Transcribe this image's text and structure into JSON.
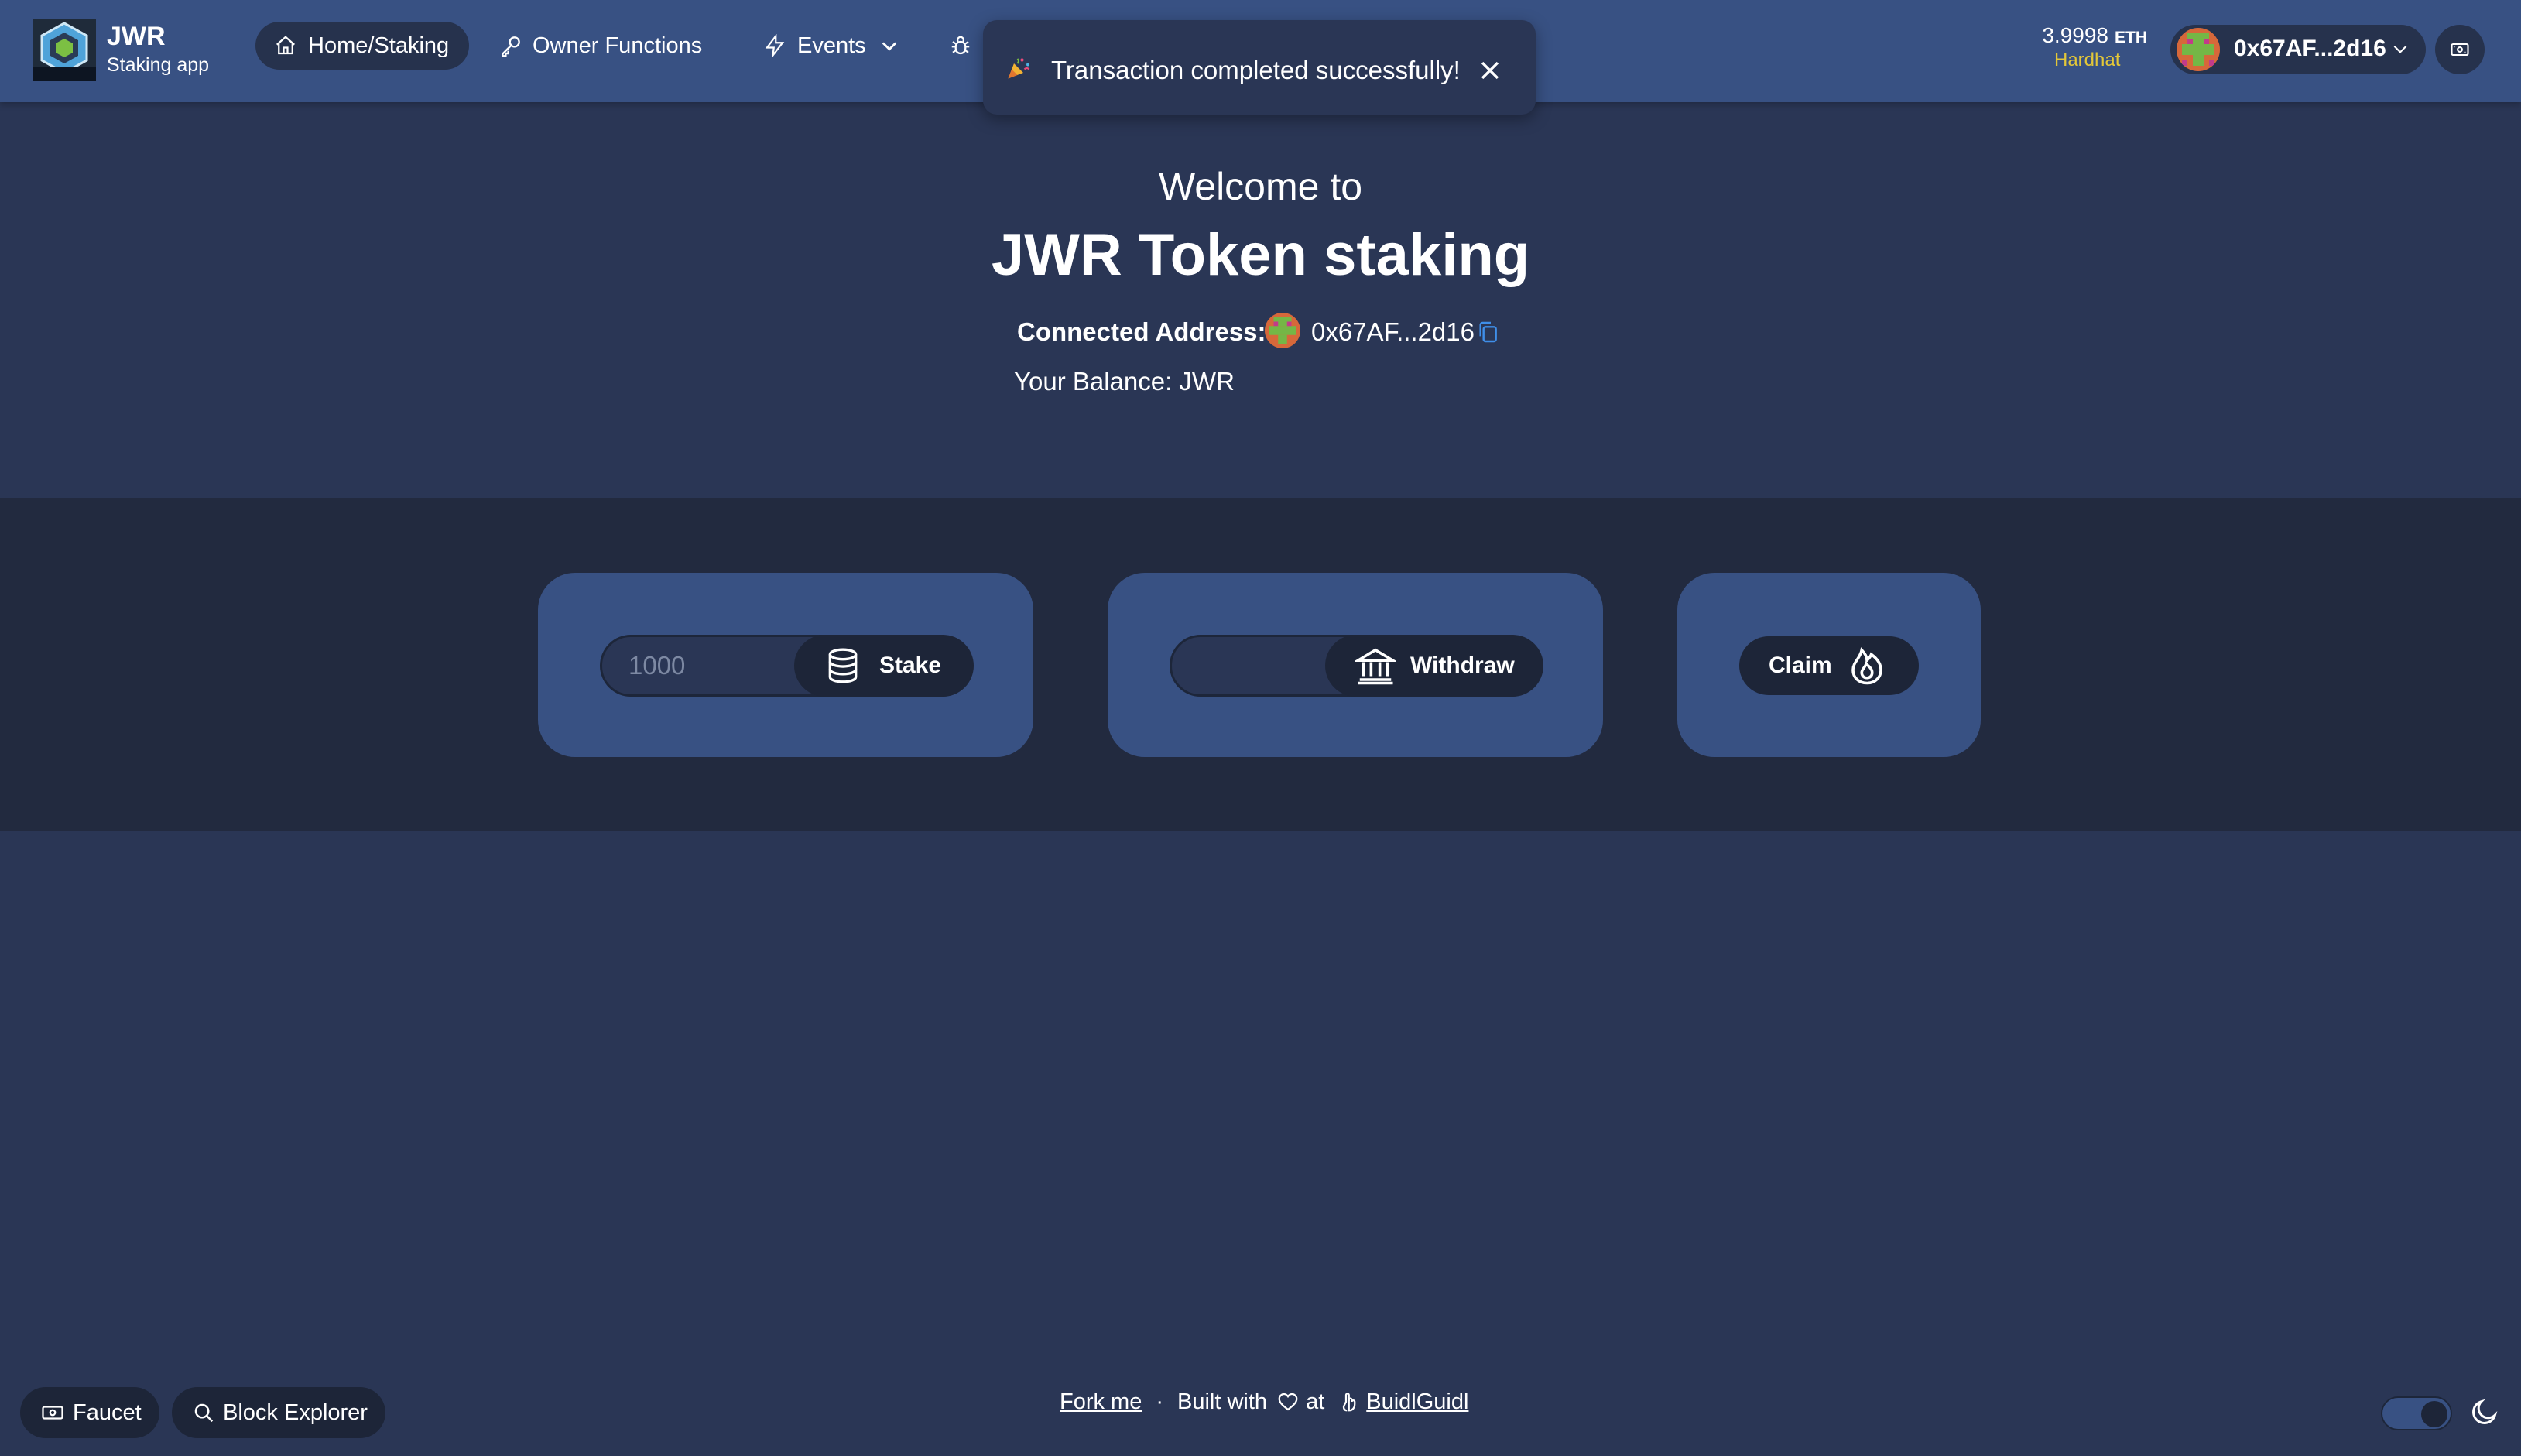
{
  "brand": {
    "title": "JWR",
    "subtitle": "Staking app",
    "logo_text": "JWR"
  },
  "nav": {
    "items": [
      {
        "label": "Home/Staking",
        "icon": "home-icon",
        "active": true
      },
      {
        "label": "Owner Functions",
        "icon": "key-icon",
        "active": false
      },
      {
        "label": "Events",
        "icon": "bolt-icon",
        "active": false,
        "dropdown": true
      }
    ]
  },
  "toast": {
    "message": "Transaction completed successfully!",
    "icon": "party-popper-icon"
  },
  "wallet": {
    "balance": "3.9998",
    "unit": "ETH",
    "network": "Hardhat",
    "address": "0x67AF...2d16"
  },
  "hero": {
    "welcome": "Welcome to",
    "title": "JWR Token staking",
    "connected_label": "Connected Address:",
    "address": "0x67AF...2d16",
    "balance_text": "Your Balance: JWR"
  },
  "actions": {
    "stake": {
      "placeholder": "1000",
      "value": "",
      "label": "Stake",
      "icon": "coin-stack-icon"
    },
    "withdraw": {
      "placeholder": "",
      "value": "",
      "label": "Withdraw",
      "icon": "bank-icon"
    },
    "claim": {
      "label": "Claim",
      "icon": "fire-icon"
    }
  },
  "footer": {
    "faucet": "Faucet",
    "block_explorer": "Block Explorer",
    "fork_me": "Fork me",
    "separator": "·",
    "built_with": "Built with",
    "at": "at",
    "buidlguidl": "BuidlGuidl"
  },
  "colors": {
    "navbar": "#385183",
    "page_bg": "#2a3655",
    "band_bg": "#222a3f",
    "card_bg": "#385183",
    "button_bg": "#1d2538",
    "network_yellow": "#e3c738"
  }
}
